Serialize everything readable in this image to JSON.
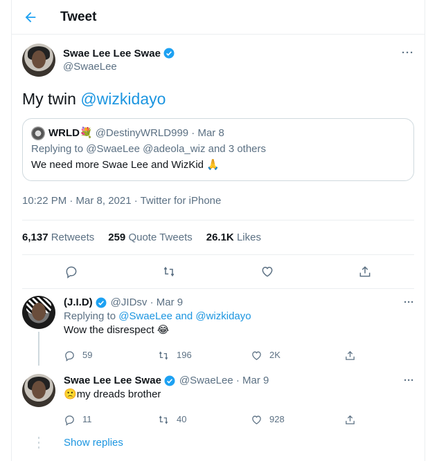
{
  "header": {
    "title": "Tweet"
  },
  "tweet": {
    "author_name": "Swae Lee Lee Swae",
    "author_handle": "@SwaeLee",
    "text_prefix": "My twin ",
    "text_mention": "@wizkidayo",
    "quote": {
      "name": "WRLD",
      "name_emoji": "💐",
      "handle_date": "@DestinyWRLD999 · Mar 8",
      "reply_prefix": "Replying to ",
      "reply_mentions": "@SwaeLee @adeola_wiz",
      "reply_suffix": " and 3 others",
      "text": "We need more Swae Lee and WizKid",
      "text_emoji": "🙏"
    },
    "meta": "10:22 PM · Mar 8, 2021 · Twitter for iPhone",
    "stats": {
      "retweets_count": "6,137",
      "retweets_label": "Retweets",
      "quotes_count": "259",
      "quotes_label": "Quote Tweets",
      "likes_count": "26.1K",
      "likes_label": "Likes"
    }
  },
  "replies": [
    {
      "name": "(J.I.D)",
      "handle_date": "@JIDsv · Mar 9",
      "replying_prefix": "Replying to ",
      "replying_to": "@SwaeLee and @wizkidayo",
      "text": "Wow the disrespect",
      "emoji": "😂",
      "reply_count": "59",
      "retweet_count": "196",
      "like_count": "2K"
    },
    {
      "name": "Swae Lee Lee Swae",
      "handle_date": "@SwaeLee · Mar 9",
      "emoji": "🙁",
      "text": "my dreads brother",
      "reply_count": "11",
      "retweet_count": "40",
      "like_count": "928"
    }
  ],
  "show_replies": "Show replies",
  "colors": {
    "accent": "#1da1f2",
    "link": "#1b95e0",
    "muted": "#5b7083"
  }
}
